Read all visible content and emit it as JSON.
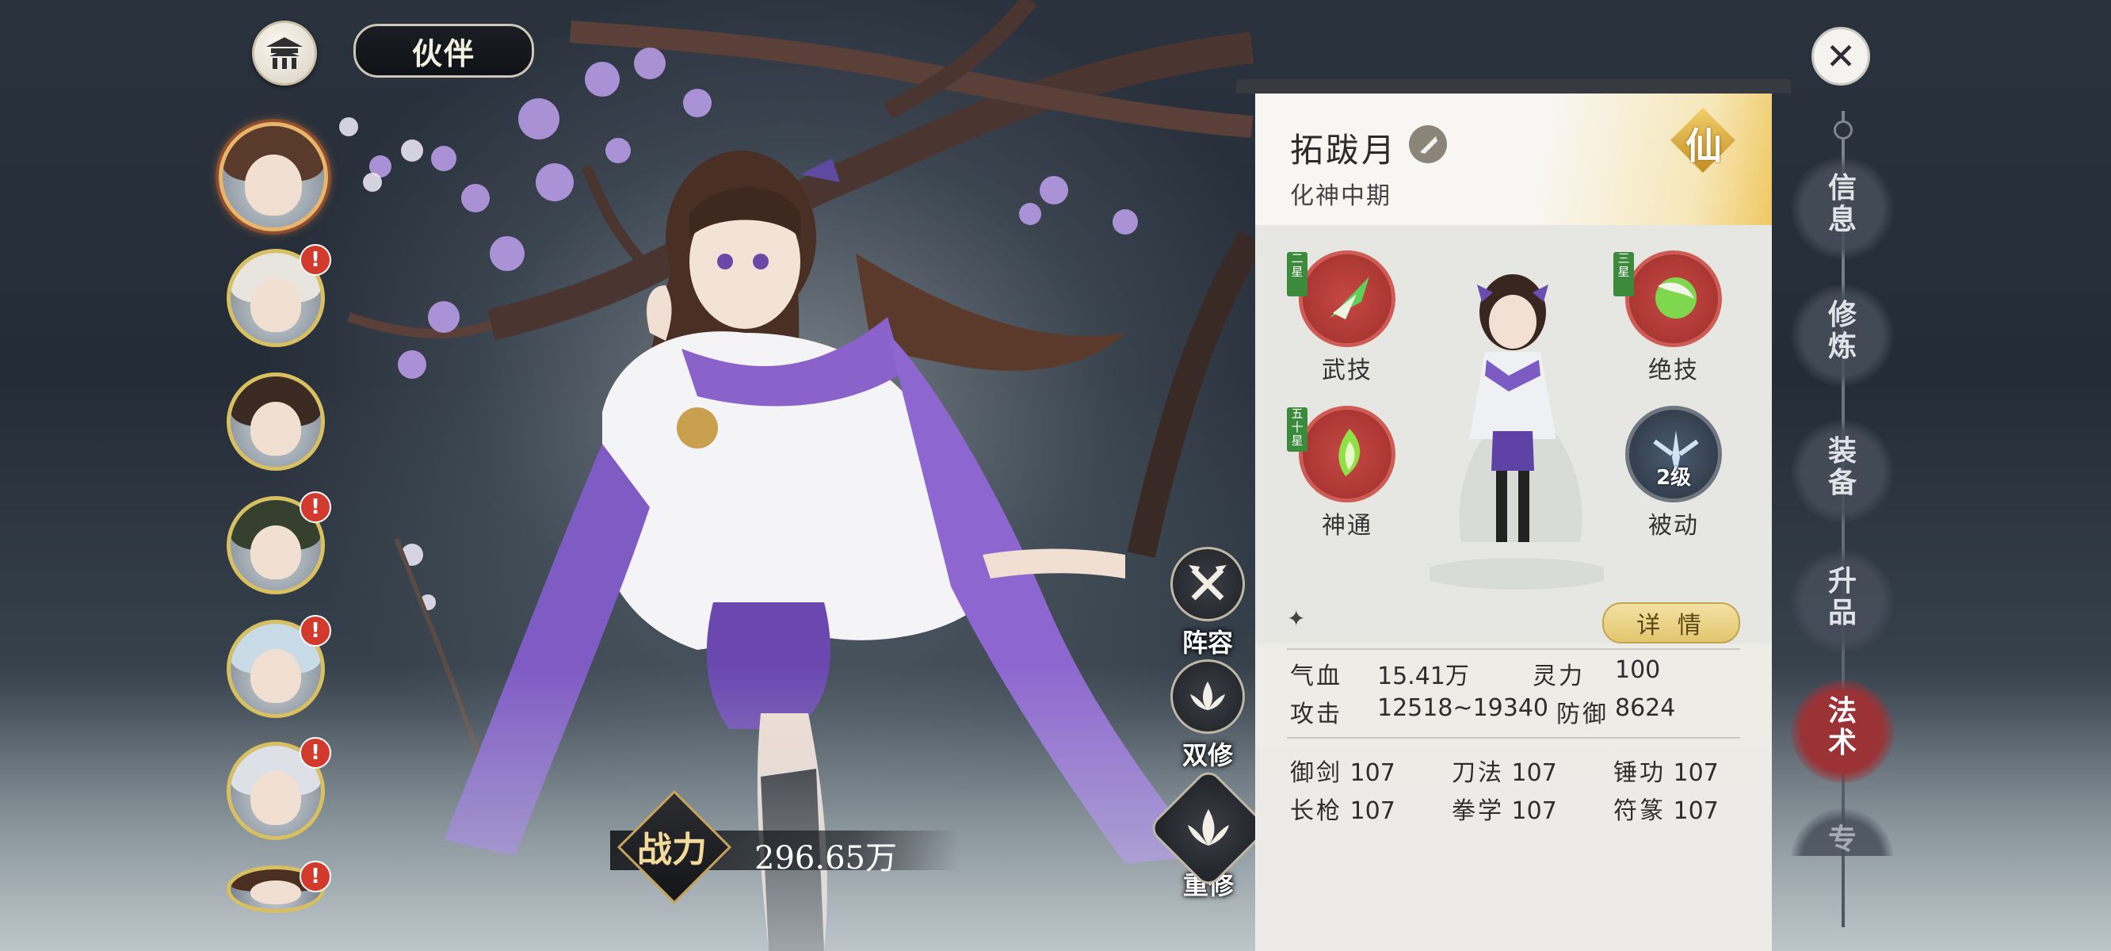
{
  "header": {
    "title": "伙伴"
  },
  "actions": [
    {
      "id": "lineup",
      "label": "阵容"
    },
    {
      "id": "dual",
      "label": "双修"
    },
    {
      "id": "recultivate",
      "label": "重修"
    }
  ],
  "power": {
    "label": "战力",
    "value": "296.65万"
  },
  "character": {
    "name": "拓跋月",
    "realm": "化神中期",
    "grade": "仙"
  },
  "skills": [
    {
      "label": "武技",
      "star": "二星",
      "level": ""
    },
    {
      "label": "绝技",
      "star": "三星",
      "level": ""
    },
    {
      "label": "神通",
      "star": "五十星",
      "level": ""
    },
    {
      "label": "被动",
      "star": "",
      "level": "2级"
    }
  ],
  "detail_button": "详 情",
  "stats": {
    "hp_label": "气血",
    "hp": "15.41万",
    "spirit_label": "灵力",
    "spirit": "100",
    "atk_label": "攻击",
    "atk": "12518~19340",
    "def_label": "防御",
    "def": "8624"
  },
  "arts": [
    {
      "label": "御剑",
      "value": "107"
    },
    {
      "label": "刀法",
      "value": "107"
    },
    {
      "label": "锤功",
      "value": "107"
    },
    {
      "label": "长枪",
      "value": "107"
    },
    {
      "label": "拳学",
      "value": "107"
    },
    {
      "label": "符篆",
      "value": "107"
    }
  ],
  "nav": [
    {
      "label": "信息",
      "active": false
    },
    {
      "label": "修炼",
      "active": false
    },
    {
      "label": "装备",
      "active": false
    },
    {
      "label": "升品",
      "active": false
    },
    {
      "label": "法术",
      "active": true
    },
    {
      "label": "专",
      "active": false
    }
  ],
  "portraits": [
    {
      "selected": true,
      "alert": false,
      "hair": "#5a3a2a"
    },
    {
      "selected": false,
      "alert": true,
      "hair": "#e8e4de"
    },
    {
      "selected": false,
      "alert": false,
      "hair": "#3b2a22"
    },
    {
      "selected": false,
      "alert": true,
      "hair": "#35402f"
    },
    {
      "selected": false,
      "alert": true,
      "hair": "#c9dbe6"
    },
    {
      "selected": false,
      "alert": true,
      "hair": "#dde0e6"
    },
    {
      "selected": false,
      "alert": true,
      "hair": "#4b3022"
    }
  ],
  "colors": {
    "accent_gold": "#e2c66f",
    "nav_active": "#9b3236",
    "alert": "#d23a2e"
  },
  "close_icon": "close-icon",
  "alert_mark": "!"
}
